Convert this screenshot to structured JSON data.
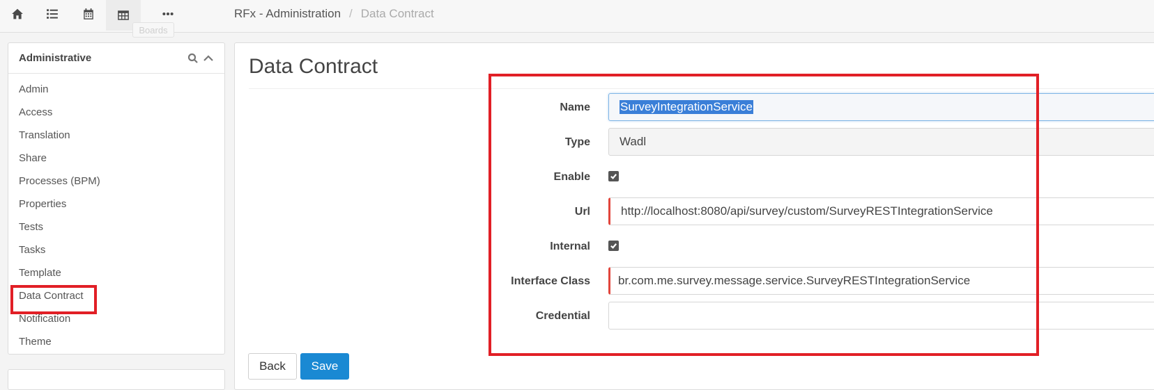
{
  "topbar": {
    "icons": [
      {
        "name": "home-icon"
      },
      {
        "name": "list-icon"
      },
      {
        "name": "calendar-icon"
      },
      {
        "name": "table-icon"
      },
      {
        "name": "more-icon"
      }
    ],
    "tooltip": "Boards",
    "breadcrumb": {
      "parent": "RFx - Administration",
      "separator": "/",
      "current": "Data Contract"
    }
  },
  "sidebar": {
    "title": "Administrative",
    "items": [
      {
        "label": "Admin"
      },
      {
        "label": "Access"
      },
      {
        "label": "Translation"
      },
      {
        "label": "Share"
      },
      {
        "label": "Processes (BPM)"
      },
      {
        "label": "Properties"
      },
      {
        "label": "Tests"
      },
      {
        "label": "Tasks"
      },
      {
        "label": "Template"
      },
      {
        "label": "Data Contract",
        "selected": true
      },
      {
        "label": "Notification"
      },
      {
        "label": "Theme"
      }
    ]
  },
  "main": {
    "title": "Data Contract",
    "form": {
      "name": {
        "label": "Name",
        "value": "SurveyIntegrationService"
      },
      "type": {
        "label": "Type",
        "value": "Wadl"
      },
      "enable": {
        "label": "Enable",
        "checked": true
      },
      "url": {
        "label": "Url",
        "value": "http://localhost:8080/api/survey/custom/SurveyRESTIntegrationService"
      },
      "internal": {
        "label": "Internal",
        "checked": true
      },
      "interface_class": {
        "label": "Interface Class",
        "value": "br.com.me.survey.message.service.SurveyRESTIntegrationService"
      },
      "credential": {
        "label": "Credential",
        "value": ""
      }
    },
    "buttons": {
      "back": "Back",
      "save": "Save"
    }
  },
  "colors": {
    "highlight": "#e11f26",
    "primary": "#1a89d3",
    "invalid": "#e2453c"
  }
}
